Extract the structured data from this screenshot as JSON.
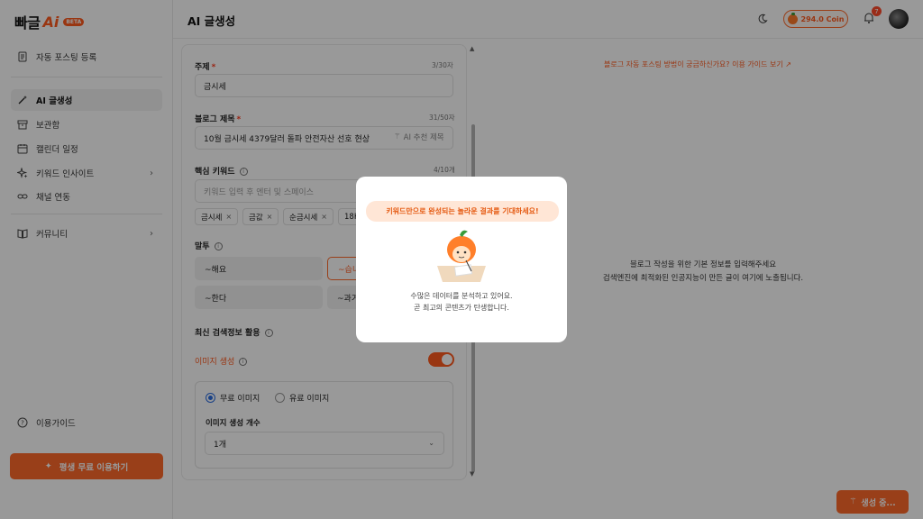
{
  "brand": {
    "logo_text": "빠글",
    "logo_ai": "Ai",
    "badge": "BETA"
  },
  "sidebar": {
    "items": [
      {
        "label": "자동 포스팅 등록",
        "icon": "document-icon"
      },
      {
        "label": "AI 글생성",
        "icon": "magic-wand-icon",
        "active": true
      },
      {
        "label": "보관함",
        "icon": "archive-icon"
      },
      {
        "label": "캘린더 일정",
        "icon": "calendar-icon"
      },
      {
        "label": "키워드 인사이트",
        "icon": "sparkle-icon"
      },
      {
        "label": "채널 연동",
        "icon": "link-icon"
      },
      {
        "label": "커뮤니티",
        "icon": "book-icon"
      }
    ],
    "help_label": "이용가이드",
    "cta_label": "평생 무료 이용하기"
  },
  "header": {
    "title": "AI 글생성",
    "coin_label": "294.0 Coin",
    "notification_count": "7"
  },
  "form": {
    "topic": {
      "label": "주제",
      "counter": "3/30자",
      "value": "금시세"
    },
    "blog_title": {
      "label": "블로그 제목",
      "counter": "31/50자",
      "value": "10월 금시세 4379달러 돌파 안전자산 선호 현상",
      "ai_button": "AI 추천 제목"
    },
    "keywords": {
      "label": "핵심 키워드",
      "counter": "4/10개",
      "placeholder": "키워드 입력 후 엔터 및 스페이스",
      "chips": [
        "금시세",
        "금값",
        "순금시세",
        "18K"
      ]
    },
    "tone": {
      "label": "말투",
      "options": [
        "~해요",
        "~습니",
        "~한다",
        "~과거"
      ]
    },
    "search_info": {
      "label": "최신 검색정보 활용"
    },
    "image_gen": {
      "label": "이미지 생성",
      "radio_free": "무료 이미지",
      "radio_paid": "유료 이미지",
      "count_label": "이미지 생성 개수",
      "count_value": "1개"
    }
  },
  "right_panel": {
    "guide_link": "블로그 자동 포스팅 방법이 궁금하신가요? 이용 가이드 보기",
    "placeholder_line1": "블로그 작성을 위한 기본 정보를 입력해주세요",
    "placeholder_line2": "검색엔진에 최적화된 인공지능이 만든 글이 여기에 노출됩니다."
  },
  "generate_button": "생성 중...",
  "modal": {
    "bubble": "키워드만으로 완성되는 놀라운 결과를 기대하세요!",
    "line1": "수많은 데이터를 분석하고 있어요.",
    "line2": "곧 최고의 콘텐츠가 탄생합니다."
  },
  "colors": {
    "accent": "#ff5a1f",
    "accent_light": "#ffe6d6",
    "radio": "#2b6de0"
  }
}
